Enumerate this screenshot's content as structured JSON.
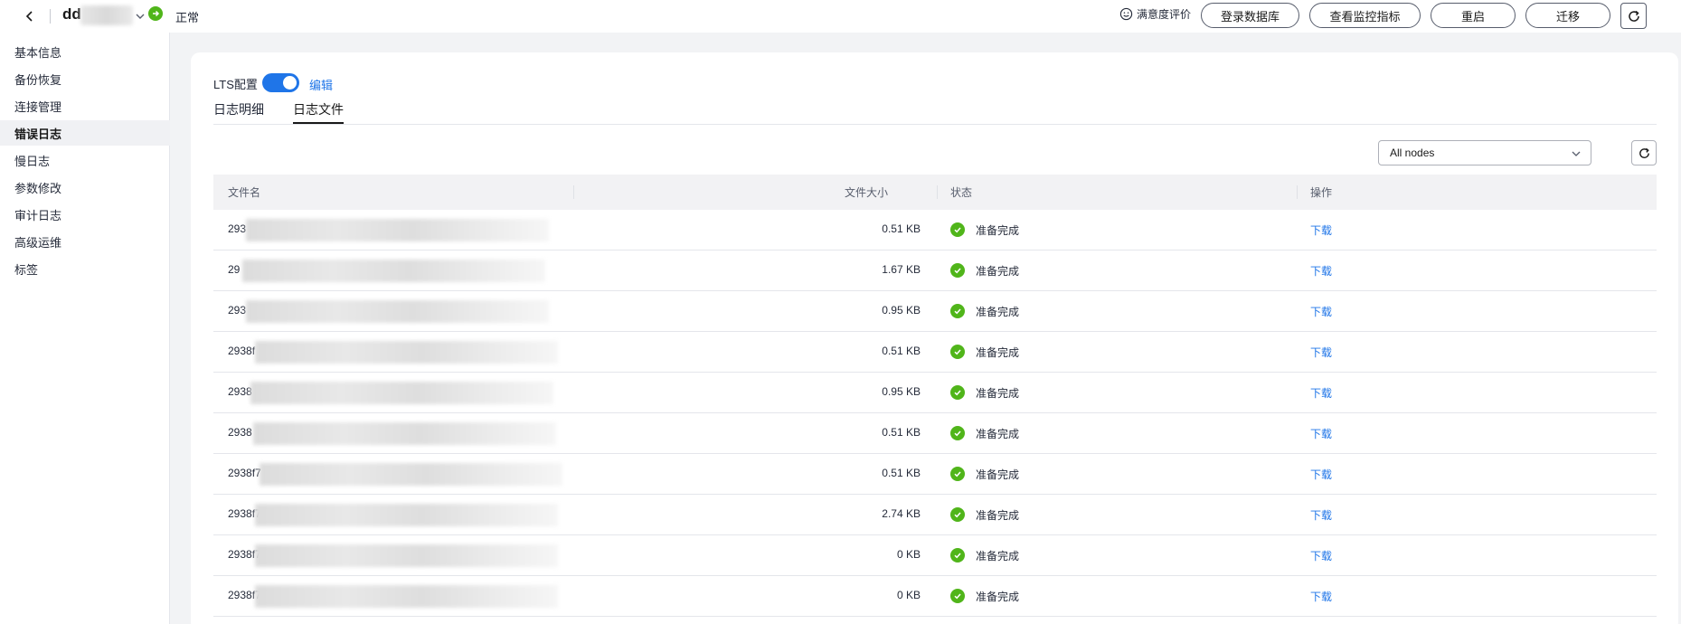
{
  "header": {
    "instance_name": "dd",
    "instance_status": "正常",
    "feedback_label": "满意度评价",
    "buttons": {
      "login_db": "登录数据库",
      "view_metrics": "查看监控指标",
      "restart": "重启",
      "migrate": "迁移"
    }
  },
  "sidebar": {
    "items": [
      {
        "label": "基本信息"
      },
      {
        "label": "备份恢复"
      },
      {
        "label": "连接管理"
      },
      {
        "label": "错误日志",
        "active": true
      },
      {
        "label": "慢日志"
      },
      {
        "label": "参数修改"
      },
      {
        "label": "审计日志"
      },
      {
        "label": "高级运维"
      },
      {
        "label": "标签"
      }
    ]
  },
  "main": {
    "lts_label": "LTS配置",
    "lts_enabled": true,
    "edit_label": "编辑",
    "tabs": [
      {
        "label": "日志明细"
      },
      {
        "label": "日志文件",
        "active": true
      }
    ],
    "node_filter": "All nodes",
    "table": {
      "columns": [
        "文件名",
        "文件大小",
        "状态",
        "操作"
      ],
      "rows": [
        {
          "name": "293",
          "size": "0.51 KB",
          "status": "准备完成",
          "action": "下载"
        },
        {
          "name": "29",
          "size": "1.67 KB",
          "status": "准备完成",
          "action": "下载"
        },
        {
          "name": "293",
          "size": "0.95 KB",
          "status": "准备完成",
          "action": "下载"
        },
        {
          "name": "2938f",
          "size": "0.51 KB",
          "status": "准备完成",
          "action": "下载"
        },
        {
          "name": "2938",
          "size": "0.95 KB",
          "status": "准备完成",
          "action": "下载"
        },
        {
          "name": "2938",
          "size": "0.51 KB",
          "status": "准备完成",
          "action": "下载"
        },
        {
          "name": "2938f7",
          "size": "0.51 KB",
          "status": "准备完成",
          "action": "下载"
        },
        {
          "name": "2938f7",
          "size": "2.74 KB",
          "status": "准备完成",
          "action": "下载"
        },
        {
          "name": "2938f7",
          "size": "0 KB",
          "status": "准备完成",
          "action": "下载"
        },
        {
          "name": "2938f7",
          "size": "0 KB",
          "status": "准备完成",
          "action": "下载"
        }
      ]
    }
  },
  "colors": {
    "accent": "#1f75e8",
    "success": "#50b51a"
  }
}
